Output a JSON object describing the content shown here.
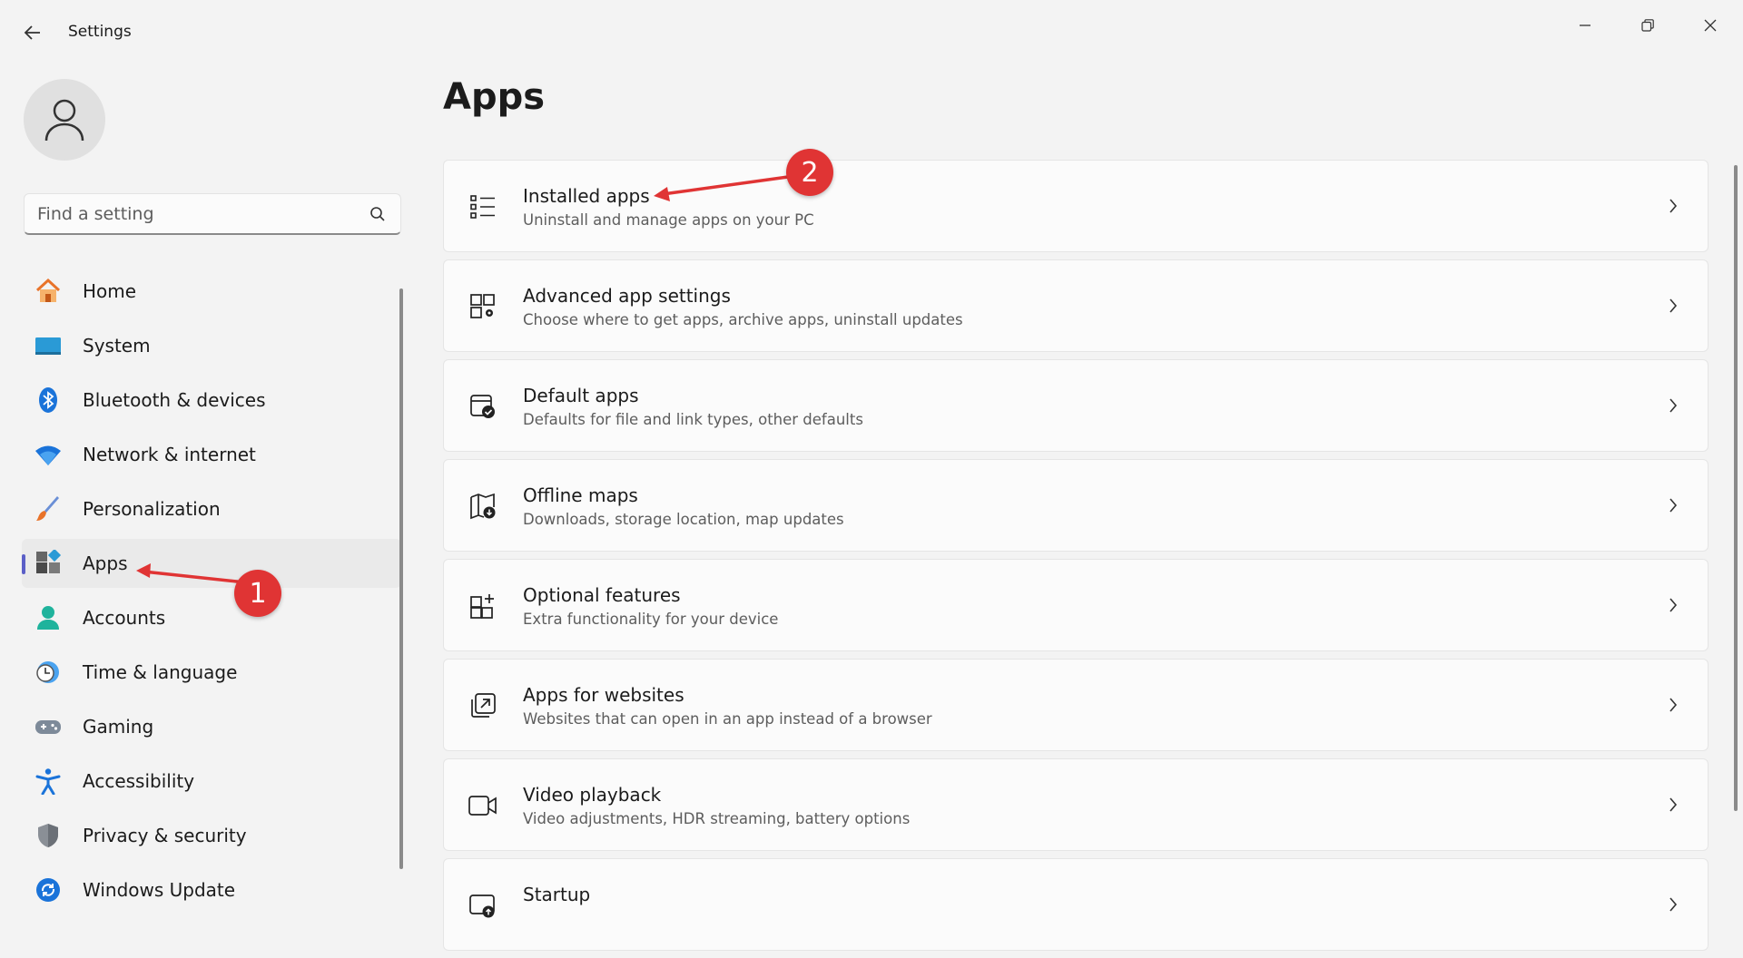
{
  "window": {
    "title": "Settings",
    "controls": [
      "minimize",
      "restore",
      "close"
    ]
  },
  "search": {
    "placeholder": "Find a setting"
  },
  "sidebar": {
    "items": [
      {
        "label": "Home",
        "icon": "home-icon"
      },
      {
        "label": "System",
        "icon": "system-icon"
      },
      {
        "label": "Bluetooth & devices",
        "icon": "bluetooth-icon"
      },
      {
        "label": "Network & internet",
        "icon": "wifi-icon"
      },
      {
        "label": "Personalization",
        "icon": "brush-icon"
      },
      {
        "label": "Apps",
        "icon": "apps-icon",
        "selected": true
      },
      {
        "label": "Accounts",
        "icon": "accounts-icon"
      },
      {
        "label": "Time & language",
        "icon": "time-language-icon"
      },
      {
        "label": "Gaming",
        "icon": "gamepad-icon"
      },
      {
        "label": "Accessibility",
        "icon": "accessibility-icon"
      },
      {
        "label": "Privacy & security",
        "icon": "shield-icon"
      },
      {
        "label": "Windows Update",
        "icon": "update-icon"
      }
    ]
  },
  "main": {
    "title": "Apps",
    "cards": [
      {
        "title": "Installed apps",
        "desc": "Uninstall and manage apps on your PC",
        "icon": "list-icon"
      },
      {
        "title": "Advanced app settings",
        "desc": "Choose where to get apps, archive apps, uninstall updates",
        "icon": "app-settings-icon"
      },
      {
        "title": "Default apps",
        "desc": "Defaults for file and link types, other defaults",
        "icon": "default-apps-icon"
      },
      {
        "title": "Offline maps",
        "desc": "Downloads, storage location, map updates",
        "icon": "map-icon"
      },
      {
        "title": "Optional features",
        "desc": "Extra functionality for your device",
        "icon": "optional-features-icon"
      },
      {
        "title": "Apps for websites",
        "desc": "Websites that can open in an app instead of a browser",
        "icon": "apps-websites-icon"
      },
      {
        "title": "Video playback",
        "desc": "Video adjustments, HDR streaming, battery options",
        "icon": "video-icon"
      },
      {
        "title": "Startup",
        "desc": "",
        "icon": "startup-icon"
      }
    ]
  },
  "annotations": {
    "callout_1": "1",
    "callout_2": "2",
    "color": "#e03434"
  },
  "colors": {
    "accent": "#5b5fc7",
    "background": "#f3f3f3",
    "card": "#fbfbfb"
  }
}
